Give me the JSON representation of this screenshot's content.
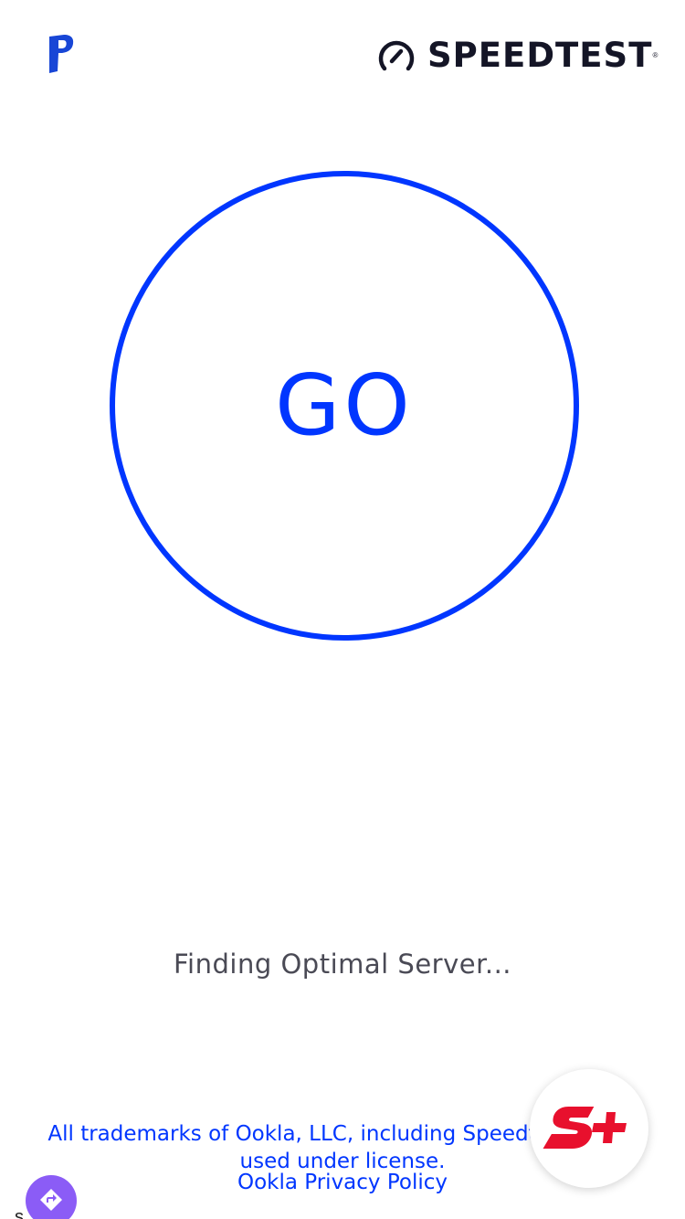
{
  "header": {
    "brand_logo_icon": "p-logo-icon",
    "speedtest_icon": "gauge-icon",
    "speedtest_text": "SPEEDTEST",
    "speedtest_reg": "®"
  },
  "main": {
    "go_label": "GO",
    "status": "Finding Optimal Server..."
  },
  "footer": {
    "trademark": "All trademarks of Ookla, LLC, including Speedtest®, are used under license.",
    "privacy_link": "Ookla Privacy Policy"
  },
  "floating": {
    "splus_icon": "s-plus-icon",
    "directions_icon": "directions-icon",
    "corner_char": "s"
  },
  "colors": {
    "accent": "#0036ff",
    "status_text": "#4a4a55",
    "splus_red": "#e8102d",
    "directions_purple": "#8b5cf6"
  }
}
